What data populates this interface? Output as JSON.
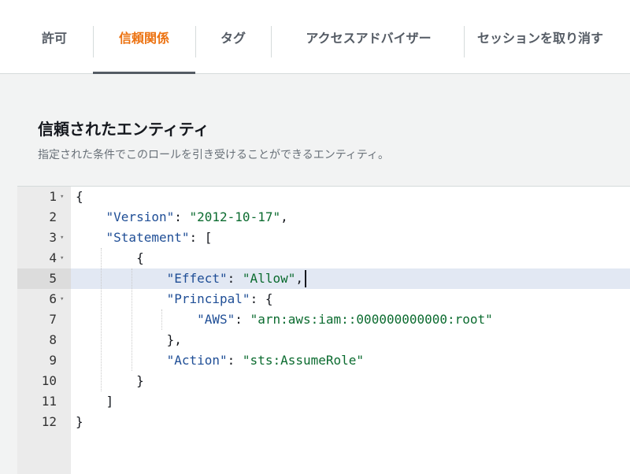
{
  "tabs": [
    {
      "label": "許可",
      "active": false
    },
    {
      "label": "信頼関係",
      "active": true
    },
    {
      "label": "タグ",
      "active": false
    },
    {
      "label": "アクセスアドバイザー",
      "active": false
    },
    {
      "label": "セッションを取り消す",
      "active": false
    }
  ],
  "section": {
    "title": "信頼されたエンティティ",
    "description": "指定された条件でこのロールを引き受けることができるエンティティ。"
  },
  "editor": {
    "active_line": 5,
    "lines": [
      {
        "num": "1",
        "foldable": true,
        "tokens": [
          {
            "t": "p",
            "v": "{"
          }
        ]
      },
      {
        "num": "2",
        "foldable": false,
        "tokens": [
          {
            "t": "p",
            "v": "    "
          },
          {
            "t": "k",
            "v": "\"Version\""
          },
          {
            "t": "p",
            "v": ": "
          },
          {
            "t": "s",
            "v": "\"2012-10-17\""
          },
          {
            "t": "p",
            "v": ","
          }
        ]
      },
      {
        "num": "3",
        "foldable": true,
        "tokens": [
          {
            "t": "p",
            "v": "    "
          },
          {
            "t": "k",
            "v": "\"Statement\""
          },
          {
            "t": "p",
            "v": ": ["
          }
        ]
      },
      {
        "num": "4",
        "foldable": true,
        "tokens": [
          {
            "t": "p",
            "v": "        {"
          }
        ]
      },
      {
        "num": "5",
        "foldable": false,
        "tokens": [
          {
            "t": "p",
            "v": "            "
          },
          {
            "t": "k",
            "v": "\"Effect\""
          },
          {
            "t": "p",
            "v": ": "
          },
          {
            "t": "s",
            "v": "\"Allow\""
          },
          {
            "t": "p",
            "v": ","
          }
        ]
      },
      {
        "num": "6",
        "foldable": true,
        "tokens": [
          {
            "t": "p",
            "v": "            "
          },
          {
            "t": "k",
            "v": "\"Principal\""
          },
          {
            "t": "p",
            "v": ": {"
          }
        ]
      },
      {
        "num": "7",
        "foldable": false,
        "tokens": [
          {
            "t": "p",
            "v": "                "
          },
          {
            "t": "k",
            "v": "\"AWS\""
          },
          {
            "t": "p",
            "v": ": "
          },
          {
            "t": "s",
            "v": "\"arn:aws:iam::000000000000:root\""
          }
        ]
      },
      {
        "num": "8",
        "foldable": false,
        "tokens": [
          {
            "t": "p",
            "v": "            },"
          }
        ]
      },
      {
        "num": "9",
        "foldable": false,
        "tokens": [
          {
            "t": "p",
            "v": "            "
          },
          {
            "t": "k",
            "v": "\"Action\""
          },
          {
            "t": "p",
            "v": ": "
          },
          {
            "t": "s",
            "v": "\"sts:AssumeRole\""
          }
        ]
      },
      {
        "num": "10",
        "foldable": false,
        "tokens": [
          {
            "t": "p",
            "v": "        }"
          }
        ]
      },
      {
        "num": "11",
        "foldable": false,
        "tokens": [
          {
            "t": "p",
            "v": "    ]"
          }
        ]
      },
      {
        "num": "12",
        "foldable": false,
        "tokens": [
          {
            "t": "p",
            "v": "}"
          }
        ]
      }
    ]
  },
  "colors": {
    "accent": "#ec7211",
    "key": "#1f4e96",
    "string": "#0b6b2f",
    "active_line": "#e2e8f3"
  },
  "icons": {
    "fold": "fold-arrow-icon"
  }
}
